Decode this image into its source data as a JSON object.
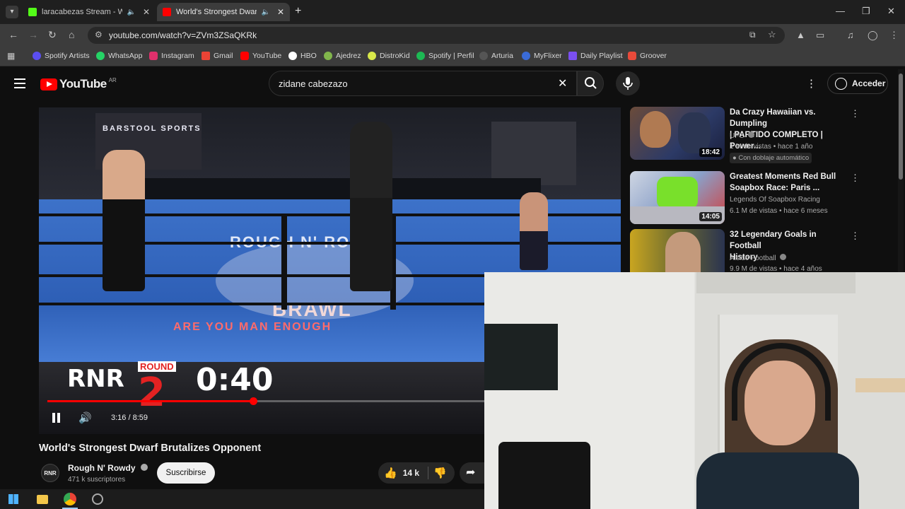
{
  "browser": {
    "tabs": [
      {
        "title": "laracabezas Stream - Watch",
        "active": false,
        "favicon_color": "#53fc18"
      },
      {
        "title": "World's Strongest Dwarf Br",
        "active": true,
        "favicon_color": "#ff0000"
      }
    ],
    "url": "youtube.com/watch?v=ZVm3ZSaQKRk",
    "bookmarks": [
      {
        "label": "Spotify Artists",
        "color": "#5b4ef0"
      },
      {
        "label": "WhatsApp",
        "color": "#25d366"
      },
      {
        "label": "Instagram",
        "color": "#e1306c"
      },
      {
        "label": "Gmail",
        "color": "#ea4335"
      },
      {
        "label": "YouTube",
        "color": "#ff0000"
      },
      {
        "label": "HBO",
        "color": "#ffffff"
      },
      {
        "label": "Ajedrez",
        "color": "#81b64c"
      },
      {
        "label": "DistroKid",
        "color": "#d8e84a"
      },
      {
        "label": "Spotify | Perfil",
        "color": "#1db954"
      },
      {
        "label": "Arturia",
        "color": "#555555"
      },
      {
        "label": "MyFlixer",
        "color": "#3a6bd6"
      },
      {
        "label": "Daily Playlist",
        "color": "#7a4ff0"
      },
      {
        "label": "Groover",
        "color": "#e84a3a"
      }
    ]
  },
  "youtube": {
    "logo_text": "YouTube",
    "country_code": "AR",
    "search_query": "zidane cabezazo",
    "signin_label": "Acceder",
    "video": {
      "title": "World's Strongest Dwarf Brutalizes Opponent",
      "current_time": "3:16",
      "duration": "8:59",
      "time_display": "3:16 / 8:59",
      "progress": 0.364,
      "overlay_brand": "RNR",
      "overlay_round_label": "ROUND",
      "overlay_round": "2",
      "overlay_clock": "0:40",
      "banner_text": "ARE YOU MAN ENOUGH",
      "brawl_text": "BRAWL",
      "rowdy_text": "ROUGH N' ROWDY",
      "sponsor_text": "BARSTOOL SPORTS"
    },
    "channel": {
      "name": "Rough N' Rowdy",
      "avatar_text": "RNR",
      "subscribers": "471 k suscriptores",
      "subscribe_label": "Suscribirse"
    },
    "actions": {
      "likes": "14 k"
    },
    "recommendations": [
      {
        "title_line1": "Da Crazy Hawaiian vs. Dumpling",
        "title_line2": "| PARTIDO COMPLETO | Power...",
        "channel": "UFC",
        "meta": "1 M de vistas • hace 1 año",
        "duration": "18:42",
        "badge": "Con doblaje automático"
      },
      {
        "title_line1": "Greatest Moments Red Bull",
        "title_line2": "Soapbox Race: Paris ...",
        "channel": "Legends Of Soapbox Racing",
        "meta": "6.1 M de vistas • hace 6 meses",
        "duration": "14:05"
      },
      {
        "title_line1": "32 Legendary Goals in Football",
        "title_line2": "History",
        "channel": "Alsido Football",
        "meta": "9.9 M de vistas • hace 4 años"
      }
    ]
  }
}
